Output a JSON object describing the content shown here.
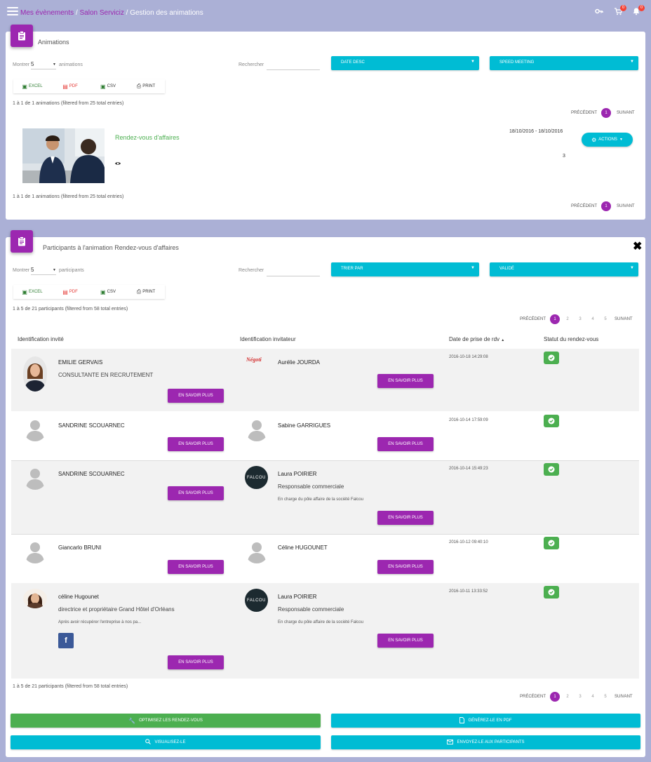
{
  "breadcrumb": {
    "item1": "Mes évènements",
    "item2": "Salon Serviciz",
    "current": "Gestion des animations",
    "sep": "/"
  },
  "topbar": {
    "cart_count": "0",
    "notif_count": "0"
  },
  "animations": {
    "title": "Animations",
    "show_label": "Montrer",
    "show_value": "5",
    "show_suffix": "animations",
    "search_label": "Rechercher",
    "filter1": "DATE DESC",
    "filter2": "SPEED MEETING",
    "export": {
      "excel": "EXCEL",
      "pdf": "PDF",
      "csv": "CSV",
      "print": "PRINT"
    },
    "info": "1 à 1 de 1 animations (filtered from 25 total entries)",
    "pager": {
      "prev": "PRÉCÉDENT",
      "pages": [
        "1"
      ],
      "next": "SUIVANT"
    },
    "item": {
      "title": "Rendez-vous d'affaires",
      "dates": "18/10/2016 - 18/10/2016",
      "count": "3",
      "actions": "ACTIONS"
    }
  },
  "participants": {
    "title": "Participants à l'animation Rendez-vous d'affaires",
    "show_label": "Montrer",
    "show_value": "5",
    "show_suffix": "participants",
    "search_label": "Rechercher",
    "filter1": "TRIER PAR",
    "filter2": "VALIDÉ",
    "export": {
      "excel": "EXCEL",
      "pdf": "PDF",
      "csv": "CSV",
      "print": "PRINT"
    },
    "info": "1 à 5 de 21 participants (filtered from 58 total entries)",
    "pager": {
      "prev": "PRÉCÉDENT",
      "pages": [
        "1",
        "2",
        "3",
        "4",
        "5"
      ],
      "next": "SUIVANT"
    },
    "columns": [
      "Identification invité",
      "Identification invitateur",
      "Date de prise de rdv",
      "Statut du rendez-vous"
    ],
    "sort_mark": "▲",
    "more_label": "EN SAVOIR PLUS",
    "rows": [
      {
        "guest": {
          "name": "EMILIE GERVAIS",
          "role": "CONSULTANTE EN RECRUTEMENT"
        },
        "host": {
          "name": "Aurélie JOURDA",
          "logo_text": "Négoti"
        },
        "date": "2016-10-18 14:29:08"
      },
      {
        "guest": {
          "name": "SANDRINE SCOUARNEC"
        },
        "host": {
          "name": "Sabine GARRIGUES"
        },
        "date": "2016-10-14 17:59:09"
      },
      {
        "guest": {
          "name": "SANDRINE SCOUARNEC"
        },
        "host": {
          "name": "Laura POIRIER",
          "role": "Responsable commerciale",
          "desc": "En charge du pôle affaire de la société Falcou",
          "logo_text": "FALCOU"
        },
        "date": "2016-10-14 15:49:23"
      },
      {
        "guest": {
          "name": "Giancarlo BRUNI"
        },
        "host": {
          "name": "Céline HUGOUNET"
        },
        "date": "2016-10-12 09:40:10"
      },
      {
        "guest": {
          "name": "céline Hugounet",
          "role": "directrice et propriétaire Grand Hôtel d'Orléans",
          "desc": "Après avoir récupérer l'entreprise à nos pa..."
        },
        "host": {
          "name": "Laura POIRIER",
          "role": "Responsable commerciale",
          "desc": "En charge du pôle affaire de la société Falcou",
          "logo_text": "FALCOU"
        },
        "date": "2016-10-11 13:33:52"
      }
    ]
  },
  "actions": {
    "optimize": "OPTIMISEZ LES RENDEZ-VOUS",
    "pdf": "GÉNÉREZ-LE EN PDF",
    "view": "VISUALISEZ-LE",
    "send": "ENVOYEZ-LE AUX PARTICIPANTS"
  },
  "colors": {
    "purple": "#9c27b0",
    "cyan": "#00bcd4",
    "green": "#4caf50",
    "background": "#abb0d6"
  }
}
